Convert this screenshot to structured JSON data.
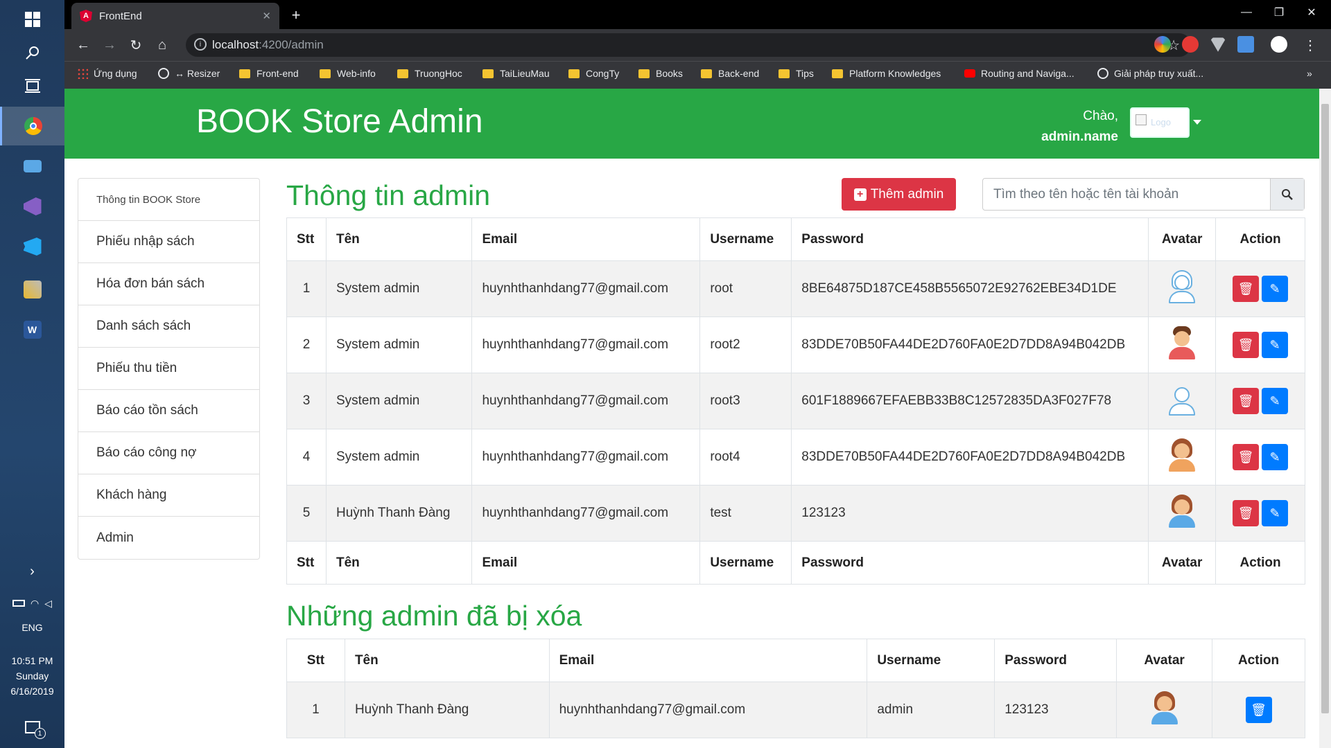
{
  "taskbar": {
    "lang": "ENG",
    "time": "10:51 PM",
    "day": "Sunday",
    "date": "6/16/2019",
    "notif_count": "1"
  },
  "browser": {
    "tab_title": "FrontEnd",
    "url_host": "localhost",
    "url_rest": ":4200/admin",
    "bookmarks": [
      "Ứng dụng",
      "↔ Resizer",
      "Front-end",
      "Web-info",
      "TruongHoc",
      "TaiLieuMau",
      "CongTy",
      "Books",
      "Back-end",
      "Tips",
      "Platform Knowledges",
      "Routing and Naviga...",
      "Giải pháp truy xuất..."
    ],
    "bookmarks_more": "»"
  },
  "header": {
    "brand": "BOOK Store Admin",
    "greeting": "Chào,",
    "username": "admin.name",
    "avatar_alt": "Logo"
  },
  "sidebar": {
    "items": [
      "Thông tin BOOK Store",
      "Phiếu nhập sách",
      "Hóa đơn bán sách",
      "Danh sách sách",
      "Phiếu thu tiền",
      "Báo cáo tồn sách",
      "Báo cáo công nợ",
      "Khách hàng",
      "Admin"
    ]
  },
  "main": {
    "title": "Thông tin admin",
    "add_button": "Thêm admin",
    "search_placeholder": "Tìm theo tên hoặc tên tài khoản",
    "columns": [
      "Stt",
      "Tên",
      "Email",
      "Username",
      "Password",
      "Avatar",
      "Action"
    ],
    "rows": [
      {
        "stt": "1",
        "name": "System admin",
        "email": "huynhthanhdang77@gmail.com",
        "username": "root",
        "password": "8BE64875D187CE458B5565072E92762EBE34D1DE",
        "avatar": "female-outline-avatar"
      },
      {
        "stt": "2",
        "name": "System admin",
        "email": "huynhthanhdang77@gmail.com",
        "username": "root2",
        "password": "83DDE70B50FA44DE2D760FA0E2D7DD8A94B042DB",
        "avatar": "male-red-shirt-avatar"
      },
      {
        "stt": "3",
        "name": "System admin",
        "email": "huynhthanhdang77@gmail.com",
        "username": "root3",
        "password": "601F1889667EFAEBB33B8C12572835DA3F027F78",
        "avatar": "male-outline-avatar"
      },
      {
        "stt": "4",
        "name": "System admin",
        "email": "huynhthanhdang77@gmail.com",
        "username": "root4",
        "password": "83DDE70B50FA44DE2D760FA0E2D7DD8A94B042DB",
        "avatar": "female-brown-hair-avatar"
      },
      {
        "stt": "5",
        "name": "Huỳnh Thanh Đàng",
        "email": "huynhthanhdang77@gmail.com",
        "username": "test",
        "password": "123123",
        "avatar": "female-brown-hair-avatar"
      }
    ]
  },
  "deleted": {
    "title": "Những admin đã bị xóa",
    "columns": [
      "Stt",
      "Tên",
      "Email",
      "Username",
      "Password",
      "Avatar",
      "Action"
    ],
    "rows": [
      {
        "stt": "1",
        "name": "Huỳnh Thanh Đàng",
        "email": "huynhthanhdang77@gmail.com",
        "username": "admin",
        "password": "123123",
        "avatar": "female-brown-hair-avatar"
      }
    ]
  },
  "colors": {
    "primary_green": "#28a745",
    "danger_red": "#dc3545",
    "primary_blue": "#007bff"
  }
}
